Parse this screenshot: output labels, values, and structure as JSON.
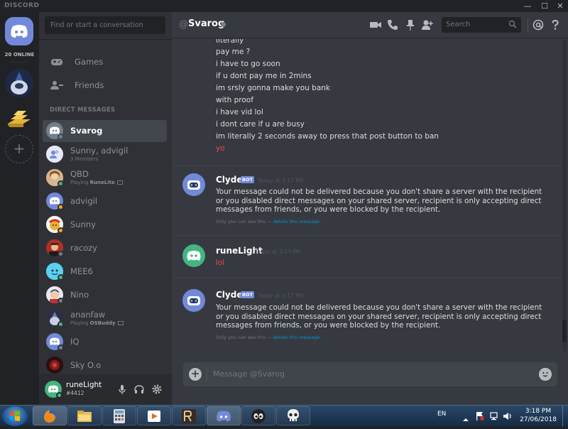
{
  "window": {
    "brand": "DISCORD",
    "controls": [
      "—",
      "☐",
      "✕"
    ]
  },
  "guilds": {
    "online_count": "20 ONLINE",
    "add_label": "+"
  },
  "sidebar": {
    "search_placeholder": "Find or start a conversation",
    "nav": [
      {
        "label": "Games",
        "icon": "gamepad-icon"
      },
      {
        "label": "Friends",
        "icon": "friends-icon"
      }
    ],
    "dm_header": "DIRECT MESSAGES",
    "dms": [
      {
        "name": "Svarog",
        "sub": "",
        "status": "offline",
        "active": true,
        "avatar_color": "#747f8d"
      },
      {
        "name": "Sunny, advigil",
        "sub": "3 Members",
        "status": "",
        "active": false,
        "avatar_color": "#7289da"
      },
      {
        "name": "QBD",
        "sub_prefix": "Playing ",
        "sub_game": "RuneLite",
        "status": "online",
        "active": false,
        "avatar_color": "#c8a27a"
      },
      {
        "name": "advigil",
        "sub": "",
        "status": "idle",
        "active": false,
        "avatar_color": "#7289da"
      },
      {
        "name": "Sunny",
        "sub": "",
        "status": "idle",
        "active": false,
        "avatar_color": "#e0a030"
      },
      {
        "name": "racozy",
        "sub": "",
        "status": "offline",
        "active": false,
        "avatar_color": "#c0392b"
      },
      {
        "name": "MEE6",
        "sub": "",
        "status": "online",
        "active": false,
        "avatar_color": "#5ad1f0"
      },
      {
        "name": "Nino",
        "sub": "",
        "status": "offline",
        "active": false,
        "avatar_color": "#3b5a8c"
      },
      {
        "name": "ananfaw",
        "sub_prefix": "Playing ",
        "sub_game": "OSBuddy",
        "status": "online",
        "active": false,
        "avatar_color": "#4a4a6a"
      },
      {
        "name": "IQ",
        "sub": "",
        "status": "offline",
        "active": false,
        "avatar_color": "#7289da"
      },
      {
        "name": "Sky O.o",
        "sub": "",
        "status": "",
        "active": false,
        "avatar_color": "#5a1a1a"
      }
    ]
  },
  "user_panel": {
    "username": "runeLight",
    "tag": "#4412"
  },
  "header": {
    "at": "@",
    "title": "Svarog",
    "search_placeholder": "Search"
  },
  "messages": {
    "continued_lines": [
      {
        "text": "literally",
        "red": false
      },
      {
        "text": "pay me ?",
        "red": false
      },
      {
        "text": "i have to go soon",
        "red": false
      },
      {
        "text": "if u dont pay me in 2mins",
        "red": false
      },
      {
        "text": "im srsly gonna make you bank",
        "red": false
      },
      {
        "text": "with proof",
        "red": false
      },
      {
        "text": "i have vid lol",
        "red": false
      },
      {
        "text": "i dont care if u are busy",
        "red": false
      },
      {
        "text": "im literally 2 seconds away to press that post button to ban",
        "red": false
      },
      {
        "text": "yo",
        "red": true
      }
    ],
    "groups": [
      {
        "author": "Clyde",
        "bot": "BOT",
        "timestamp": "Today at 3:17 PM",
        "body": "Your message could not be delivered because you don't share a server with the recipient or you disabled direct messages on your shared server, recipient is only accepting direct messages from friends, or you were blocked by the recipient.",
        "ephemeral_text": "Only you can see this — ",
        "ephemeral_link": "delete this message."
      },
      {
        "author": "runeLight",
        "bot": "",
        "timestamp": "Today at 3:17 PM",
        "body": "lol"
      },
      {
        "author": "Clyde",
        "bot": "BOT",
        "timestamp": "Today at 3:17 PM",
        "body": "Your message could not be delivered because you don't share a server with the recipient or you disabled direct messages on your shared server, recipient is only accepting direct messages from friends, or you were blocked by the recipient.",
        "ephemeral_text": "Only you can see this — ",
        "ephemeral_link": "delete this message."
      }
    ]
  },
  "composer": {
    "placeholder": "Message @Svarog"
  },
  "taskbar": {
    "language": "EN",
    "time": "3:18 PM",
    "date": "27/06/2018"
  },
  "colors": {
    "blurple": "#7289da",
    "online": "#43b581",
    "idle": "#faa61a",
    "offline": "#747f8d",
    "danger": "#f04747"
  }
}
